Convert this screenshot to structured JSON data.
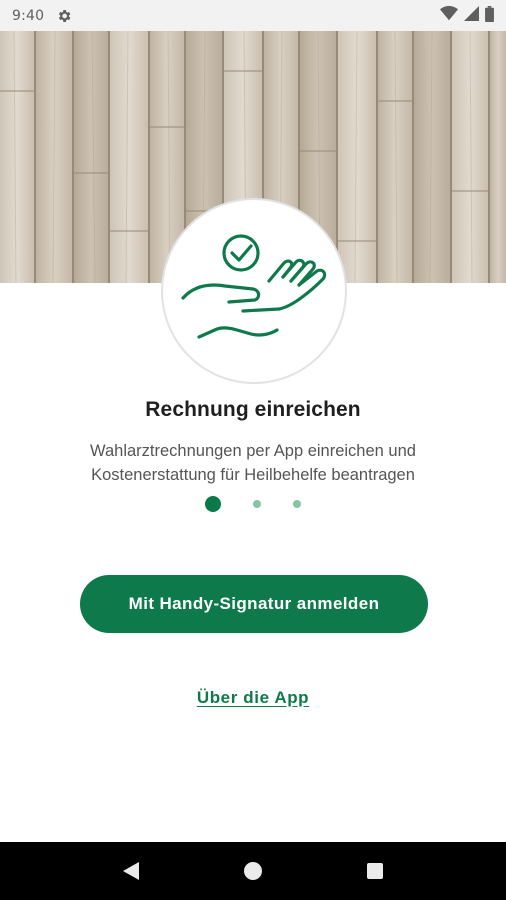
{
  "status_bar": {
    "time": "9:40",
    "icons": [
      "settings-icon",
      "wifi-icon",
      "signal-icon",
      "battery-icon"
    ]
  },
  "onboarding": {
    "illustration": "hand-check-icon",
    "title": "Rechnung einreichen",
    "description": "Wahlarztrechnungen per App einreichen und Kostenerstattung für Heilbehelfe beantragen",
    "page_indicator": {
      "total": 3,
      "current": 1
    }
  },
  "actions": {
    "login_button": "Mit Handy-Signatur anmelden",
    "about_link": "Über die App"
  },
  "nav_bar": {
    "buttons": [
      "back-icon",
      "home-icon",
      "recents-icon"
    ]
  },
  "colors": {
    "accent": "#0e7a4c",
    "dot_inactive": "#86c2a6",
    "nav_bar": "#000000",
    "status_bar": "#f2f2f2"
  }
}
